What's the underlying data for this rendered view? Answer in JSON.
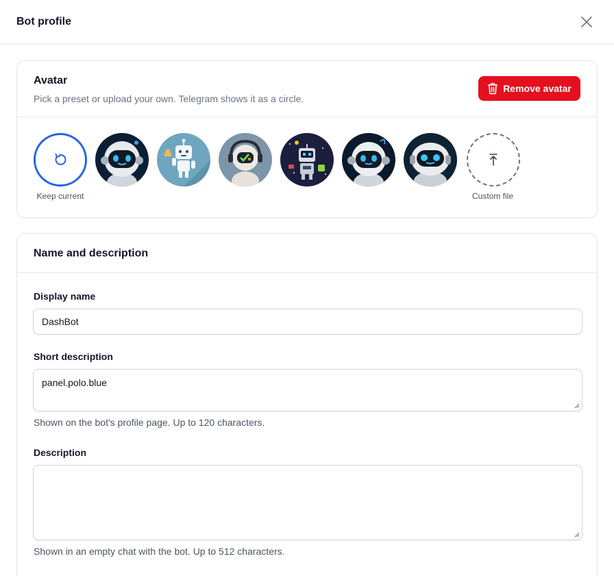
{
  "header": {
    "title": "Bot profile"
  },
  "avatar_section": {
    "title": "Avatar",
    "subtitle": "Pick a preset or upload your own. Telegram shows it as a circle.",
    "remove_label": "Remove avatar",
    "keep_label": "Keep current",
    "custom_label": "Custom file"
  },
  "name_section": {
    "title": "Name and description",
    "display_name_label": "Display name",
    "display_name_value": "DashBot",
    "short_desc_label": "Short description",
    "short_desc_value": "panel.polo.blue",
    "short_desc_help": "Shown on the bot's profile page. Up to 120 characters.",
    "desc_label": "Description",
    "desc_value": "",
    "desc_help": "Shown in an empty chat with the bot. Up to 512 characters."
  },
  "colors": {
    "accent": "#2563eb",
    "danger": "#e5101d"
  }
}
